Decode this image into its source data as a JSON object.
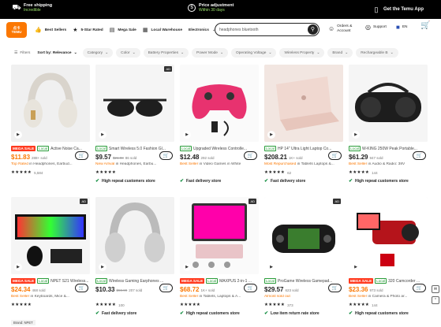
{
  "promo": {
    "shipping_title": "Free shipping",
    "shipping_sub": "Incredible",
    "adjust_title": "Price adjustment",
    "adjust_sub": "Within 30 days",
    "app_label": "Get the Temu App"
  },
  "header": {
    "logo_line1": "点卡",
    "logo_line2": "TEMU",
    "nav": [
      "Best Sellers",
      "5-Star Rated",
      "Mega Sale",
      "Local Warehouse",
      "Electronics"
    ],
    "search_value": "headphones bluetooth",
    "orders_line1": "Orders &",
    "orders_line2": "Account",
    "support": "Support",
    "lang": "EN"
  },
  "filters": {
    "filter_label": "Filters",
    "sort_label": "Sort by: Relevance",
    "chips": [
      "Category",
      "Color",
      "Battery Properties",
      "Power Mode",
      "Operating Voltage",
      "Wireless Property",
      "Brand",
      "Rechargeable B"
    ]
  },
  "products": [
    {
      "mega": "MEGA SALE",
      "local": "Local",
      "title": "Active Noise Ca...",
      "price": "$11.83",
      "orig": "",
      "sold": "288+ sold",
      "sub_hl": "Top Rated",
      "sub": " in Headphones, Earbud...",
      "rating": "★★★★★",
      "count": "5,584",
      "badge": "",
      "ad": ""
    },
    {
      "mega": "",
      "local": "Local",
      "title": "Smart Wireless 5.0 Fashion Gl...",
      "price": "$9.57",
      "orig": "$21.98",
      "sold": "86 sold",
      "sub_hl": "New Arrival",
      "sub": " in Headphones, Earbu...",
      "rating": "★★★★★",
      "count": "",
      "badge": "High repeat customers store",
      "ad": "AD"
    },
    {
      "mega": "",
      "local": "Local",
      "title": "Upgraded Wireless Controlle...",
      "price": "$12.48",
      "orig": "",
      "sold": "292 sold",
      "sub_hl": "Best Seller",
      "sub": " in Video Games in White",
      "rating": "",
      "count": "",
      "badge": "Fast delivery store",
      "ad": ""
    },
    {
      "mega": "",
      "local": "Local",
      "title": "HP 14\" Ultra Light Laptop Co...",
      "price": "$208.21",
      "orig": "",
      "sold": "1K+ sold",
      "sub_hl": "Most Repurchased",
      "sub": " in Tablets Laptops &...",
      "rating": "★★★★★",
      "count": "62",
      "badge": "Fast delivery store",
      "ad": ""
    },
    {
      "mega": "",
      "local": "Local",
      "title": "W-KING 250W Peak Portable...",
      "price": "$61.29",
      "orig": "",
      "sold": "947 sold",
      "sub_hl": "Best Seller",
      "sub": " in Audio & Radio: 38V",
      "rating": "★★★★★",
      "count": "144",
      "badge": "High repeat customers store",
      "ad": ""
    },
    {
      "mega": "MEGA SALE",
      "local": "Local",
      "title": "NPET S21 Wireless...",
      "price": "$24.34",
      "orig": "",
      "sold": "468 sold",
      "sub_hl": "Best Seller",
      "sub": " in Keyboards, Mice &...",
      "rating": "★★★★★",
      "count": "",
      "badge": "",
      "ad": "AD",
      "brand": "Brand: NPET"
    },
    {
      "mega": "",
      "local": "Local",
      "title": "Wireless Gaming Earphones ...",
      "price": "$10.33",
      "orig": "$59.99",
      "sold": "207 sold",
      "sub_hl": "",
      "sub": "",
      "rating": "★★★★★",
      "count": "100",
      "badge": "Fast delivery store",
      "ad": ""
    },
    {
      "mega": "MEGA SALE",
      "local": "Local",
      "title": "MAXPUS 2-in-1 ...",
      "price": "$68.72",
      "orig": "",
      "sold": "1K+ sold",
      "sub_hl": "Best Seller",
      "sub": " in Tablets, Laptops & A...",
      "rating": "★★★★★",
      "count": "",
      "badge": "High repeat customers store",
      "ad": "AD"
    },
    {
      "mega": "",
      "local": "Local",
      "title": "ProGame Wireless Gamepad...",
      "price": "$29.57",
      "orig": "",
      "sold": "623 sold",
      "sub_hl": "Almost sold out",
      "sub": "",
      "rating": "★★★★★",
      "count": "373",
      "badge": "Low item return rate store",
      "ad": "AD"
    },
    {
      "mega": "MEGA SALE",
      "local": "Local",
      "title": "320 Camcorder ...",
      "price": "$23.36",
      "orig": "",
      "sold": "973 sold",
      "sub_hl": "Best Seller",
      "sub": " in Camera & Photo ar...",
      "rating": "★★★★★",
      "count": "144",
      "badge": "High repeat customers store",
      "ad": ""
    }
  ]
}
